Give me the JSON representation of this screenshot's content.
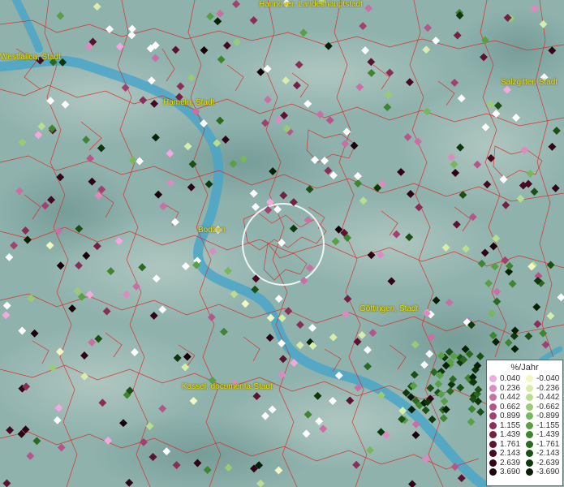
{
  "map": {
    "background": "#8fb2ad",
    "river_color": "#4aa6c8",
    "border_color": "#e0261e",
    "label_color": "#e8e600"
  },
  "cities": [
    {
      "label": "Hannover, Landeshauptstadt"
    },
    {
      "label": "Westfalica, Stadt"
    },
    {
      "label": "Salzgitter, Stadt"
    },
    {
      "label": "Hameln, Stadt"
    },
    {
      "label": "Bodzen"
    },
    {
      "label": "Göttingen, Stadt"
    },
    {
      "label": "Kassel, documenta-Stadt"
    }
  ],
  "legend": {
    "title": "%/Jahr",
    "positive": [
      {
        "value": "0.040",
        "color": "#f2a9df"
      },
      {
        "value": "0.236",
        "color": "#dd8ac2"
      },
      {
        "value": "0.442",
        "color": "#c96fa6"
      },
      {
        "value": "0.662",
        "color": "#b5568b"
      },
      {
        "value": "0.899",
        "color": "#a04171"
      },
      {
        "value": "1.155",
        "color": "#8a2e59"
      },
      {
        "value": "1.439",
        "color": "#741f44"
      },
      {
        "value": "1.761",
        "color": "#5e1232"
      },
      {
        "value": "2.143",
        "color": "#470822"
      },
      {
        "value": "2.639",
        "color": "#300315"
      },
      {
        "value": "3.690",
        "color": "#1a0009"
      }
    ],
    "negative": [
      {
        "value": "-0.040",
        "color": "#f3f7c0"
      },
      {
        "value": "-0.236",
        "color": "#d7edaa"
      },
      {
        "value": "-0.442",
        "color": "#b9de8f"
      },
      {
        "value": "-0.662",
        "color": "#98cc74"
      },
      {
        "value": "-0.899",
        "color": "#76b85b"
      },
      {
        "value": "-1.155",
        "color": "#57a044"
      },
      {
        "value": "-1.439",
        "color": "#3e8530"
      },
      {
        "value": "-1.761",
        "color": "#2a6a20"
      },
      {
        "value": "-2.143",
        "color": "#1a5014"
      },
      {
        "value": "-2.639",
        "color": "#0e380b"
      },
      {
        "value": "-3.690",
        "color": "#052004"
      }
    ]
  }
}
